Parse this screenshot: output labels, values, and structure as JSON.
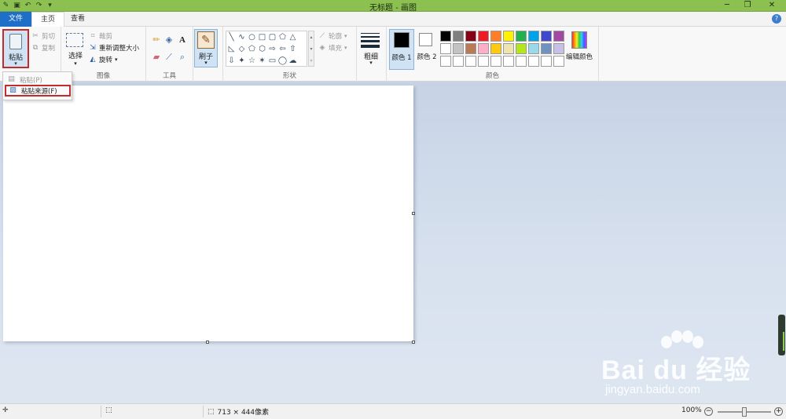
{
  "window": {
    "title": "无标题 - 画图"
  },
  "tabs": {
    "file": "文件",
    "home": "主页",
    "view": "查看"
  },
  "clipboard": {
    "paste": "粘贴",
    "cut": "剪切",
    "copy": "复制"
  },
  "image_group": {
    "label": "图像",
    "select": "选择",
    "crop": "裁剪",
    "resize": "重新调整大小",
    "rotate": "旋转"
  },
  "tools_group": {
    "label": "工具"
  },
  "brushes": {
    "label": "刷子"
  },
  "shapes_group": {
    "label": "形状",
    "outline": "轮廓",
    "fill": "填充",
    "shapes": [
      "╲",
      "∿",
      "○",
      "□",
      "▢",
      "⬠",
      "△",
      "",
      "◺",
      "◇",
      "⬠",
      "⬡",
      "⇨",
      "⇦",
      "⇧",
      "",
      "⇩",
      "✦",
      "☆",
      "✶",
      "▭",
      "◯",
      "☁",
      ""
    ]
  },
  "size_group": {
    "label": "粗细"
  },
  "colors_group": {
    "label": "颜色",
    "color1": "颜色 1",
    "color2": "颜色 2",
    "edit": "编辑颜色",
    "palette_row1": [
      "#000000",
      "#7f7f7f",
      "#880015",
      "#ed1c24",
      "#ff7f27",
      "#fff200",
      "#22b14c",
      "#00a2e8",
      "#3f48cc",
      "#a349a4"
    ],
    "palette_row2": [
      "#ffffff",
      "#c3c3c3",
      "#b97a57",
      "#ffaec9",
      "#ffc90e",
      "#efe4b0",
      "#b5e61d",
      "#99d9ea",
      "#7092be",
      "#c8bfe7"
    ],
    "palette_row3": [
      "#ffffff",
      "#ffffff",
      "#ffffff",
      "#ffffff",
      "#ffffff",
      "#ffffff",
      "#ffffff",
      "#ffffff",
      "#ffffff",
      "#ffffff"
    ]
  },
  "paste_menu": {
    "paste": "粘贴(P)",
    "paste_from": "粘贴来源(F)"
  },
  "statusbar": {
    "canvas_size": "713 × 444像素",
    "zoom": "100%"
  },
  "watermark": {
    "brand": "Bai du 经验",
    "url": "jingyan.baidu.com"
  }
}
